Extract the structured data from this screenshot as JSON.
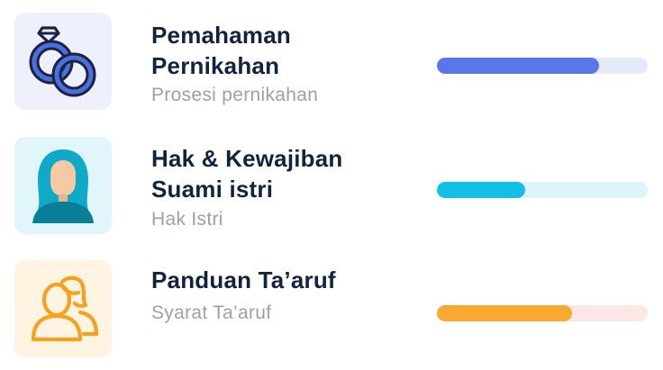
{
  "courses": [
    {
      "title": "Pemahaman Pernikahan",
      "subtitle": "Prosesi pernikahan",
      "icon": "wedding-rings-icon",
      "progress": 0.77,
      "colors": {
        "tile": "#eef1fb",
        "fill": "#5b76e8",
        "track": "#e6e9fa"
      }
    },
    {
      "title": "Hak & Kewajiban Suami istri",
      "subtitle": "Hak Istri",
      "icon": "hijab-woman-icon",
      "progress": 0.42,
      "colors": {
        "tile": "#e1f6fa",
        "fill": "#14bfe6",
        "track": "#dff4fa"
      }
    },
    {
      "title": "Panduan Ta’aruf",
      "subtitle": "Syarat Ta’aruf",
      "icon": "two-people-icon",
      "progress": 0.64,
      "colors": {
        "tile": "#fff3e2",
        "fill": "#f9a92f",
        "track": "#fde6e6"
      }
    }
  ]
}
